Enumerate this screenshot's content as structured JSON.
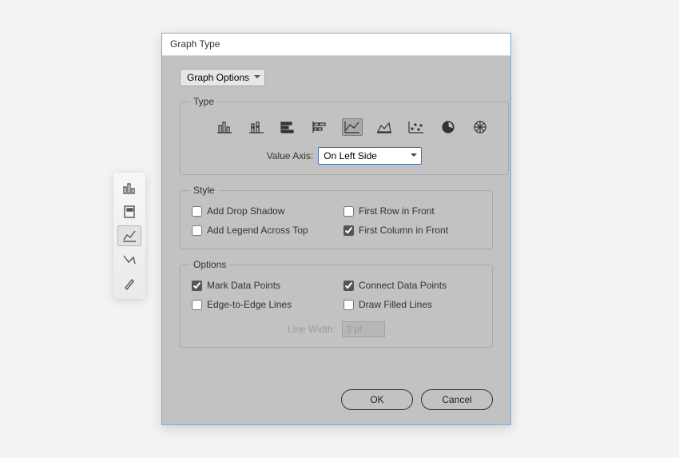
{
  "dialog": {
    "title": "Graph Type",
    "top_dropdown": "Graph Options"
  },
  "type_section": {
    "legend": "Type",
    "value_axis_label": "Value Axis:",
    "value_axis_value": "On Left Side"
  },
  "style_section": {
    "legend": "Style",
    "add_drop_shadow": "Add Drop Shadow",
    "add_legend_across_top": "Add Legend Across Top",
    "first_row_in_front": "First Row in Front",
    "first_column_in_front": "First Column in Front"
  },
  "options_section": {
    "legend": "Options",
    "mark_data_points": "Mark Data Points",
    "edge_to_edge_lines": "Edge-to-Edge Lines",
    "connect_data_points": "Connect Data Points",
    "draw_filled_lines": "Draw Filled Lines",
    "line_width_label": "Line Width:",
    "line_width_value": "3 pt"
  },
  "buttons": {
    "ok": "OK",
    "cancel": "Cancel"
  }
}
